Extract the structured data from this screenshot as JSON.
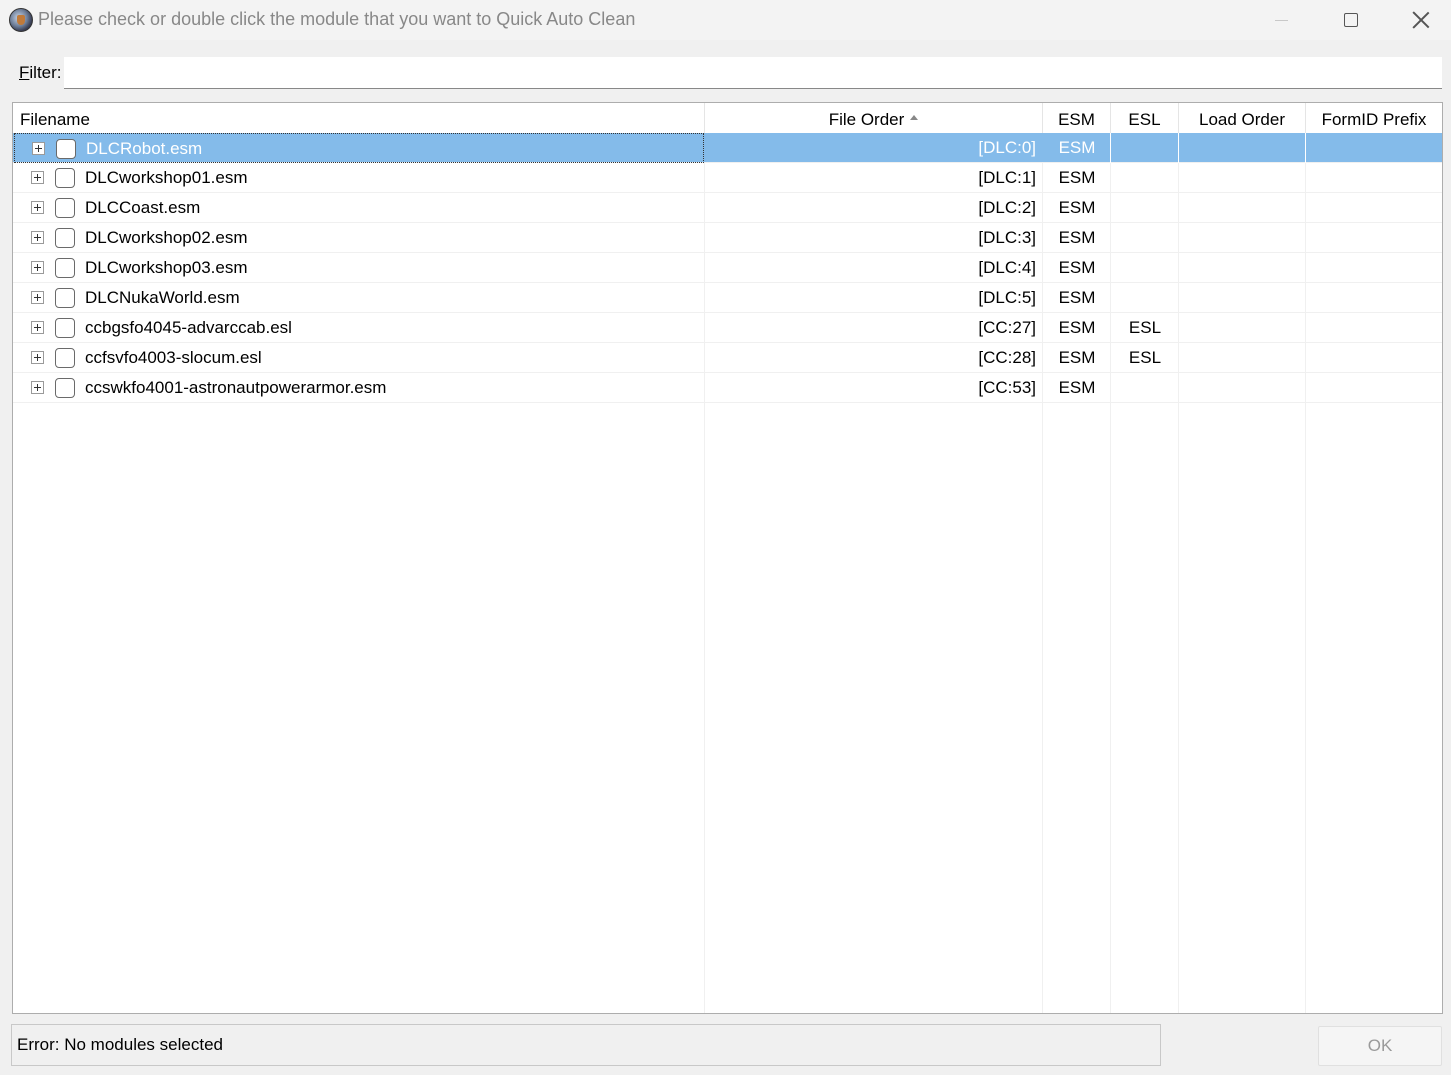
{
  "window": {
    "title": "Please check or double click the module that you want to Quick Auto Clean"
  },
  "filter": {
    "label_first": "F",
    "label_rest": "ilter:",
    "value": "",
    "placeholder": ""
  },
  "table": {
    "columns": {
      "filename": "Filename",
      "file_order": "File Order",
      "esm": "ESM",
      "esl": "ESL",
      "load_order": "Load Order",
      "formid_prefix": "FormID Prefix"
    },
    "sort": {
      "column": "File Order",
      "direction": "ascending"
    },
    "rows": [
      {
        "filename": "DLCRobot.esm",
        "file_order": "[DLC:0]",
        "esm": "ESM",
        "esl": "",
        "load_order": "",
        "formid_prefix": "",
        "selected": true
      },
      {
        "filename": "DLCworkshop01.esm",
        "file_order": "[DLC:1]",
        "esm": "ESM",
        "esl": "",
        "load_order": "",
        "formid_prefix": ""
      },
      {
        "filename": "DLCCoast.esm",
        "file_order": "[DLC:2]",
        "esm": "ESM",
        "esl": "",
        "load_order": "",
        "formid_prefix": ""
      },
      {
        "filename": "DLCworkshop02.esm",
        "file_order": "[DLC:3]",
        "esm": "ESM",
        "esl": "",
        "load_order": "",
        "formid_prefix": ""
      },
      {
        "filename": "DLCworkshop03.esm",
        "file_order": "[DLC:4]",
        "esm": "ESM",
        "esl": "",
        "load_order": "",
        "formid_prefix": ""
      },
      {
        "filename": "DLCNukaWorld.esm",
        "file_order": "[DLC:5]",
        "esm": "ESM",
        "esl": "",
        "load_order": "",
        "formid_prefix": ""
      },
      {
        "filename": "ccbgsfo4045-advarccab.esl",
        "file_order": "[CC:27]",
        "esm": "ESM",
        "esl": "ESL",
        "load_order": "",
        "formid_prefix": ""
      },
      {
        "filename": "ccfsvfo4003-slocum.esl",
        "file_order": "[CC:28]",
        "esm": "ESM",
        "esl": "ESL",
        "load_order": "",
        "formid_prefix": ""
      },
      {
        "filename": "ccswkfo4001-astronautpowerarmor.esm",
        "file_order": "[CC:53]",
        "esm": "ESM",
        "esl": "",
        "load_order": "",
        "formid_prefix": ""
      }
    ]
  },
  "status": {
    "message": "Error: No modules selected"
  },
  "buttons": {
    "ok": "OK"
  },
  "colors": {
    "selection": "#84bbea",
    "window_bg": "#f0f0f0",
    "disabled_text": "#9a9a9a"
  },
  "icons": {
    "app": "xedit-app-icon",
    "minimize": "minimize-icon",
    "maximize": "maximize-icon",
    "close": "close-icon",
    "expand": "plus-expand-icon",
    "sort": "sort-ascending-icon"
  }
}
